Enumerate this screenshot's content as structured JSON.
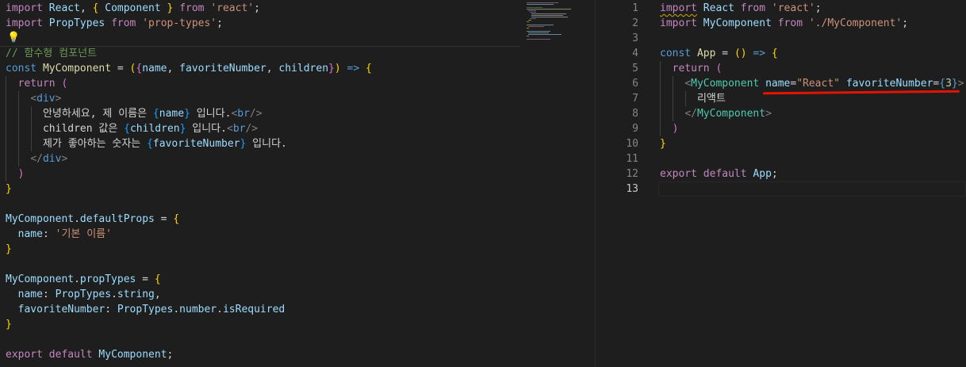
{
  "left_editor": {
    "lines": [
      [
        {
          "t": "import",
          "c": "kw"
        },
        {
          "t": " "
        },
        {
          "t": "React",
          "c": "var"
        },
        {
          "t": ", "
        },
        {
          "t": "{",
          "c": "b1"
        },
        {
          "t": " "
        },
        {
          "t": "Component",
          "c": "var"
        },
        {
          "t": " "
        },
        {
          "t": "}",
          "c": "b1"
        },
        {
          "t": " "
        },
        {
          "t": "from",
          "c": "kw"
        },
        {
          "t": " "
        },
        {
          "t": "'react'",
          "c": "str"
        },
        {
          "t": ";"
        }
      ],
      [
        {
          "t": "import",
          "c": "kw"
        },
        {
          "t": " "
        },
        {
          "t": "PropTypes",
          "c": "var"
        },
        {
          "t": " "
        },
        {
          "t": "from",
          "c": "kw"
        },
        {
          "t": " "
        },
        {
          "t": "'prop-types'",
          "c": "str"
        },
        {
          "t": ";"
        }
      ],
      [],
      [
        {
          "t": "// 함수형 컴포넌트",
          "c": "cm"
        }
      ],
      [
        {
          "t": "const",
          "c": "st"
        },
        {
          "t": " "
        },
        {
          "t": "MyComponent",
          "c": "fn"
        },
        {
          "t": " = "
        },
        {
          "t": "(",
          "c": "b1"
        },
        {
          "t": "{",
          "c": "b2"
        },
        {
          "t": "name",
          "c": "var"
        },
        {
          "t": ", "
        },
        {
          "t": "favoriteNumber",
          "c": "var"
        },
        {
          "t": ", "
        },
        {
          "t": "children",
          "c": "var"
        },
        {
          "t": "}",
          "c": "b2"
        },
        {
          "t": ")",
          "c": "b1"
        },
        {
          "t": " "
        },
        {
          "t": "=>",
          "c": "st"
        },
        {
          "t": " "
        },
        {
          "t": "{",
          "c": "b1"
        }
      ],
      [
        {
          "t": "  "
        },
        {
          "t": "return",
          "c": "kw"
        },
        {
          "t": " "
        },
        {
          "t": "(",
          "c": "b2"
        }
      ],
      [
        {
          "t": "    "
        },
        {
          "t": "<",
          "c": "tag"
        },
        {
          "t": "div",
          "c": "st"
        },
        {
          "t": ">",
          "c": "tag"
        }
      ],
      [
        {
          "t": "      안녕하세요, 제 이름은 "
        },
        {
          "t": "{",
          "c": "b3"
        },
        {
          "t": "name",
          "c": "var"
        },
        {
          "t": "}",
          "c": "b3"
        },
        {
          "t": " 입니다."
        },
        {
          "t": "<",
          "c": "tag"
        },
        {
          "t": "br",
          "c": "st"
        },
        {
          "t": "/>",
          "c": "tag"
        }
      ],
      [
        {
          "t": "      children 값은 "
        },
        {
          "t": "{",
          "c": "b3"
        },
        {
          "t": "children",
          "c": "var"
        },
        {
          "t": "}",
          "c": "b3"
        },
        {
          "t": " 입니다."
        },
        {
          "t": "<",
          "c": "tag"
        },
        {
          "t": "br",
          "c": "st"
        },
        {
          "t": "/>",
          "c": "tag"
        }
      ],
      [
        {
          "t": "      제가 좋아하는 숫자는 "
        },
        {
          "t": "{",
          "c": "b3"
        },
        {
          "t": "favoriteNumber",
          "c": "var"
        },
        {
          "t": "}",
          "c": "b3"
        },
        {
          "t": " 입니다."
        }
      ],
      [
        {
          "t": "    "
        },
        {
          "t": "</",
          "c": "tag"
        },
        {
          "t": "div",
          "c": "st"
        },
        {
          "t": ">",
          "c": "tag"
        }
      ],
      [
        {
          "t": "  "
        },
        {
          "t": ")",
          "c": "b2"
        }
      ],
      [
        {
          "t": "}",
          "c": "b1"
        }
      ],
      [],
      [
        {
          "t": "MyComponent",
          "c": "var"
        },
        {
          "t": "."
        },
        {
          "t": "defaultProps",
          "c": "var"
        },
        {
          "t": " = "
        },
        {
          "t": "{",
          "c": "b1"
        }
      ],
      [
        {
          "t": "  "
        },
        {
          "t": "name",
          "c": "var"
        },
        {
          "t": ": "
        },
        {
          "t": "'기본 이름'",
          "c": "str"
        }
      ],
      [
        {
          "t": "}",
          "c": "b1"
        }
      ],
      [],
      [
        {
          "t": "MyComponent",
          "c": "var"
        },
        {
          "t": "."
        },
        {
          "t": "propTypes",
          "c": "var"
        },
        {
          "t": " = "
        },
        {
          "t": "{",
          "c": "b1"
        }
      ],
      [
        {
          "t": "  "
        },
        {
          "t": "name",
          "c": "var"
        },
        {
          "t": ": "
        },
        {
          "t": "PropTypes",
          "c": "var"
        },
        {
          "t": "."
        },
        {
          "t": "string",
          "c": "var"
        },
        {
          "t": ","
        }
      ],
      [
        {
          "t": "  "
        },
        {
          "t": "favoriteNumber",
          "c": "var"
        },
        {
          "t": ": "
        },
        {
          "t": "PropTypes",
          "c": "var"
        },
        {
          "t": "."
        },
        {
          "t": "number",
          "c": "var"
        },
        {
          "t": "."
        },
        {
          "t": "isRequired",
          "c": "var"
        }
      ],
      [
        {
          "t": "}",
          "c": "b1"
        }
      ],
      [],
      [
        {
          "t": "export",
          "c": "kw"
        },
        {
          "t": " "
        },
        {
          "t": "default",
          "c": "kw"
        },
        {
          "t": " "
        },
        {
          "t": "MyComponent",
          "c": "var"
        },
        {
          "t": ";"
        }
      ]
    ]
  },
  "right_editor": {
    "active_line": 13,
    "lines": [
      {
        "n": "1",
        "segs": [
          {
            "t": "import",
            "c": "kw squig"
          },
          {
            "t": " "
          },
          {
            "t": "React",
            "c": "var"
          },
          {
            "t": " "
          },
          {
            "t": "from",
            "c": "kw"
          },
          {
            "t": " "
          },
          {
            "t": "'react'",
            "c": "str"
          },
          {
            "t": ";"
          }
        ]
      },
      {
        "n": "2",
        "segs": [
          {
            "t": "import",
            "c": "kw"
          },
          {
            "t": " "
          },
          {
            "t": "MyComponent",
            "c": "var"
          },
          {
            "t": " "
          },
          {
            "t": "from",
            "c": "kw"
          },
          {
            "t": " "
          },
          {
            "t": "'./MyComponent'",
            "c": "str"
          },
          {
            "t": ";"
          }
        ]
      },
      {
        "n": "3",
        "segs": []
      },
      {
        "n": "4",
        "segs": [
          {
            "t": "const",
            "c": "st"
          },
          {
            "t": " "
          },
          {
            "t": "App",
            "c": "fn"
          },
          {
            "t": " = "
          },
          {
            "t": "(",
            "c": "b1"
          },
          {
            "t": ")",
            "c": "b1"
          },
          {
            "t": " "
          },
          {
            "t": "=>",
            "c": "st"
          },
          {
            "t": " "
          },
          {
            "t": "{",
            "c": "b1"
          }
        ]
      },
      {
        "n": "5",
        "segs": [
          {
            "t": "  "
          },
          {
            "t": "return",
            "c": "kw"
          },
          {
            "t": " "
          },
          {
            "t": "(",
            "c": "b2"
          }
        ]
      },
      {
        "n": "6",
        "segs": [
          {
            "t": "    "
          },
          {
            "t": "<",
            "c": "tag"
          },
          {
            "t": "MyComponent",
            "c": "cls"
          },
          {
            "t": " "
          },
          {
            "t": "name",
            "c": "var"
          },
          {
            "t": "="
          },
          {
            "t": "\"React\"",
            "c": "str"
          },
          {
            "t": " "
          },
          {
            "t": "favoriteNumber",
            "c": "var"
          },
          {
            "t": "="
          },
          {
            "t": "{",
            "c": "st"
          },
          {
            "t": "3",
            "c": "num"
          },
          {
            "t": "}",
            "c": "st"
          },
          {
            "t": ">",
            "c": "tag"
          }
        ]
      },
      {
        "n": "7",
        "segs": [
          {
            "t": "      리액트"
          }
        ]
      },
      {
        "n": "8",
        "segs": [
          {
            "t": "    "
          },
          {
            "t": "</",
            "c": "tag"
          },
          {
            "t": "MyComponent",
            "c": "cls"
          },
          {
            "t": ">",
            "c": "tag"
          }
        ]
      },
      {
        "n": "9",
        "segs": [
          {
            "t": "  "
          },
          {
            "t": ")",
            "c": "b2"
          }
        ]
      },
      {
        "n": "10",
        "segs": [
          {
            "t": "}",
            "c": "b1"
          }
        ]
      },
      {
        "n": "11",
        "segs": []
      },
      {
        "n": "12",
        "segs": [
          {
            "t": "export",
            "c": "kw"
          },
          {
            "t": " "
          },
          {
            "t": "default",
            "c": "kw"
          },
          {
            "t": " "
          },
          {
            "t": "App",
            "c": "var"
          },
          {
            "t": ";"
          }
        ]
      },
      {
        "n": "13",
        "segs": []
      }
    ]
  },
  "icons": {
    "lightbulb": "lightbulb-icon",
    "lightbulb_glyph": "💡"
  },
  "colors": {
    "editor_bg": "#1e1e1e",
    "annotation_red": "#e51400"
  }
}
